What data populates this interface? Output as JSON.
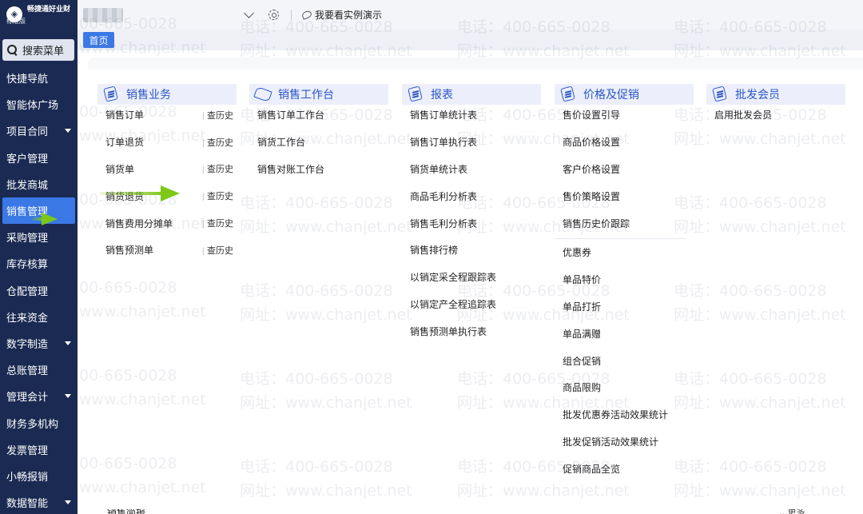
{
  "brand": {
    "name": "畅捷通好业财",
    "edition": "标准版",
    "logo_mark": "◈"
  },
  "sidebar": {
    "search_label": "搜索菜单",
    "items": [
      {
        "label": "快捷导航",
        "has_caret": false
      },
      {
        "label": "智能体广场",
        "has_caret": false
      },
      {
        "label": "项目合同",
        "has_caret": true
      },
      {
        "label": "客户管理",
        "has_caret": false
      },
      {
        "label": "批发商城",
        "has_caret": false
      },
      {
        "label": "销售管理",
        "has_caret": false,
        "active": true
      },
      {
        "label": "采购管理",
        "has_caret": false
      },
      {
        "label": "库存核算",
        "has_caret": false
      },
      {
        "label": "仓配管理",
        "has_caret": false
      },
      {
        "label": "往来资金",
        "has_caret": false
      },
      {
        "label": "数字制造",
        "has_caret": true
      },
      {
        "label": "总账管理",
        "has_caret": false
      },
      {
        "label": "管理会计",
        "has_caret": true
      },
      {
        "label": "财务多机构",
        "has_caret": false
      },
      {
        "label": "发票管理",
        "has_caret": false
      },
      {
        "label": "小畅报销",
        "has_caret": false
      },
      {
        "label": "数据智能",
        "has_caret": true
      }
    ]
  },
  "topbar": {
    "demo_label": "我要看实例演示"
  },
  "tabs": {
    "home": "首页"
  },
  "menu": {
    "columns": [
      {
        "title": "销售业务",
        "items": [
          {
            "label": "销售订单",
            "history": "查历史"
          },
          {
            "label": "订单退货",
            "history": "查历史"
          },
          {
            "label": "销货单",
            "history": "查历史"
          },
          {
            "label": "销货退货",
            "history": "查历史"
          },
          {
            "label": "销售费用分摊单",
            "history": "查历史"
          },
          {
            "label": "销售预测单",
            "history": "查历史"
          }
        ]
      },
      {
        "title": "销售工作台",
        "items": [
          {
            "label": "销售订单工作台"
          },
          {
            "label": "销货工作台"
          },
          {
            "label": "销售对账工作台"
          }
        ]
      },
      {
        "title": "报表",
        "items": [
          {
            "label": "销售订单统计表"
          },
          {
            "label": "销售订单执行表"
          },
          {
            "label": "销货单统计表"
          },
          {
            "label": "商品毛利分析表"
          },
          {
            "label": "销售毛利分析表"
          },
          {
            "label": "销售排行榜"
          },
          {
            "label": "以销定采全程跟踪表"
          },
          {
            "label": "以销定产全程追踪表"
          },
          {
            "label": "销售预测单执行表"
          }
        ]
      },
      {
        "title": "价格及促销",
        "items": [
          {
            "label": "售价设置引导"
          },
          {
            "label": "商品价格设置"
          },
          {
            "label": "客户价格设置"
          },
          {
            "label": "售价策略设置"
          },
          {
            "label": "销售历史价跟踪",
            "sep_after": true
          },
          {
            "label": "优惠券"
          },
          {
            "label": "单品特价"
          },
          {
            "label": "单品打折"
          },
          {
            "label": "单品满赠"
          },
          {
            "label": "组合促销"
          },
          {
            "label": "商品限购"
          },
          {
            "label": "批发优惠券活动效果统计"
          },
          {
            "label": "批发促销活动效果统计"
          },
          {
            "label": "促销商品全览"
          }
        ]
      },
      {
        "title": "批发会员",
        "items": [
          {
            "label": "启用批发会员"
          }
        ]
      }
    ]
  },
  "watermark": {
    "phone": "电话：400-665-0028",
    "site": "网址：www.chanjet.net",
    "phone_short": "00-665-0028",
    "site_short": "www.chanjet.net"
  },
  "bottom_peek": {
    "left": "销售简报",
    "right": "...更多"
  },
  "colors": {
    "sidebar_bg": "#1b2a52",
    "accent": "#3a78e6",
    "header_bg": "#eceffb",
    "header_text": "#2a55c8",
    "arrow": "#7cc718"
  }
}
